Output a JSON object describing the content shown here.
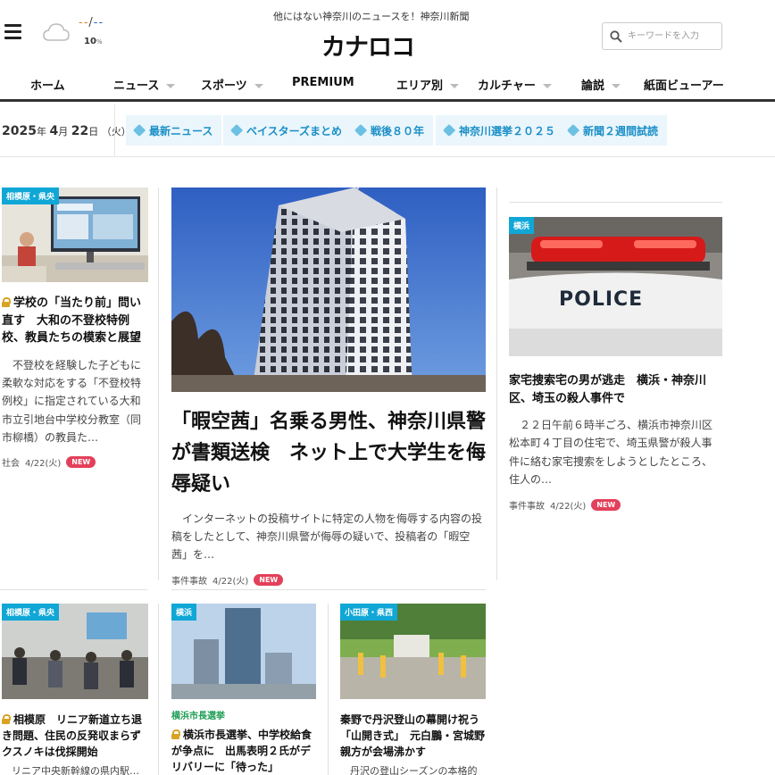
{
  "header": {
    "tagline": "他にはない神奈川のニュースを！神奈川新聞",
    "logo": "カナロコ",
    "weather": {
      "temp_low": "--",
      "sep": "/",
      "temp_high": "--",
      "rain": "10",
      "rain_unit": "%"
    },
    "search_placeholder": "キーワードを入力"
  },
  "nav": [
    {
      "label": "ホーム",
      "dropdown": false
    },
    {
      "label": "ニュース",
      "dropdown": true
    },
    {
      "label": "スポーツ",
      "dropdown": true
    },
    {
      "label": "PREMIUM",
      "dropdown": false
    },
    {
      "label": "エリア別",
      "dropdown": true
    },
    {
      "label": "カルチャー",
      "dropdown": true
    },
    {
      "label": "論説",
      "dropdown": true
    },
    {
      "label": "紙面ビューアー",
      "dropdown": false
    }
  ],
  "date": {
    "year": "2025",
    "year_unit": "年",
    "month": "4",
    "month_unit": "月",
    "day": "22",
    "day_unit": "日",
    "weekday": "（火）"
  },
  "tags": [
    "最新ニュース",
    "ベイスターズまとめ",
    "戦後８０年",
    "神奈川選挙２０２５",
    "新聞２週間試読"
  ],
  "articles": {
    "left_top": {
      "category": "相模原・県央",
      "headline": "学校の「当たり前」問い直す　大和の不登校特例校、教員たちの模索と展望",
      "summary": "不登校を経験した子どもに柔軟な対応をする「不登校特例校」に指定されている大和市立引地台中学校分教室（同市柳橋）の教員た…",
      "section": "社会",
      "date": "4/22(火)",
      "badge": "NEW"
    },
    "main": {
      "headline": "「暇空茜」名乗る男性、神奈川県警が書類送検　ネット上で大学生を侮辱疑い",
      "summary": "インターネットの投稿サイトに特定の人物を侮辱する内容の投稿をしたとして、神奈川県警が侮辱の疑いで、投稿者の「暇空茜」を…",
      "section": "事件事故",
      "date": "4/22(火)",
      "badge": "NEW"
    },
    "right_top": {
      "category": "横浜",
      "headline": "家宅捜索宅の男が逃走　横浜・神奈川区、埼玉の殺人事件で",
      "summary": "２２日午前６時半ごろ、横浜市神奈川区松本町４丁目の住宅で、埼玉県警が殺人事件に絡む家宅捜索をしようとしたところ、住人の…",
      "section": "事件事故",
      "date": "4/22(火)",
      "badge": "NEW",
      "image_text": "POLICE"
    },
    "bottom1": {
      "category": "相模原・県央",
      "headline": "相模原　リニア新道立ち退き問題、住民の反発収まらず　クスノキは伐採開始",
      "summary": "リニア中央新幹線の県内駅…の新設"
    },
    "bottom2": {
      "category": "横浜",
      "sublabel": "横浜市長選挙",
      "headline": "横浜市長選挙、中学校給食が争点に　出馬表明２氏がデリバリーに「待った」"
    },
    "bottom3": {
      "category": "小田原・県西",
      "headline": "秦野で丹沢登山の幕開け祝う「山開き式」　元白鵬・宮城野親方が会場沸かす",
      "summary": "丹沢の登山シーズンの本格的な幕"
    }
  }
}
